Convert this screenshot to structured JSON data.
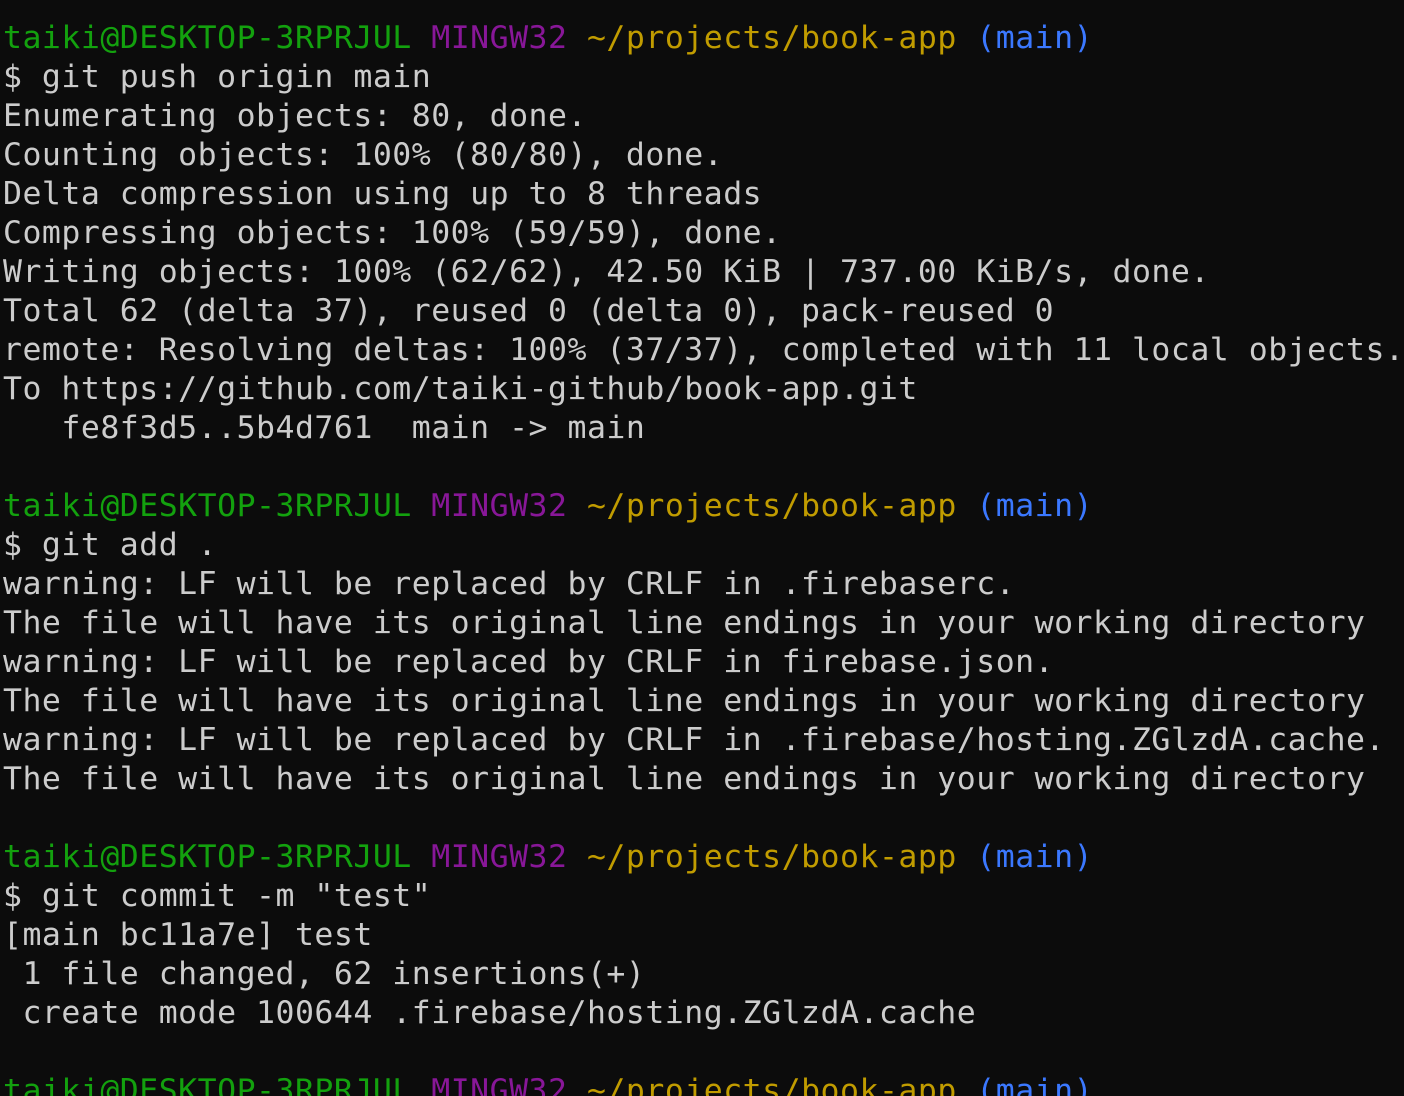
{
  "colors": {
    "background": "#0c0c0c",
    "foreground": "#cccccc",
    "user": "#13a10e",
    "env": "#881798",
    "path": "#c19c00",
    "branch": "#3b78ff"
  },
  "prompt": {
    "user_host": "taiki@DESKTOP-3RPRJUL",
    "env": "MINGW32",
    "path": "~/projects/book-app",
    "branch": "(main)"
  },
  "blocks": [
    {
      "command": "$ git push origin main",
      "output": [
        "Enumerating objects: 80, done.",
        "Counting objects: 100% (80/80), done.",
        "Delta compression using up to 8 threads",
        "Compressing objects: 100% (59/59), done.",
        "Writing objects: 100% (62/62), 42.50 KiB | 737.00 KiB/s, done.",
        "Total 62 (delta 37), reused 0 (delta 0), pack-reused 0",
        "remote: Resolving deltas: 100% (37/37), completed with 11 local objects.",
        "To https://github.com/taiki-github/book-app.git",
        "   fe8f3d5..5b4d761  main -> main"
      ]
    },
    {
      "command": "$ git add .",
      "output": [
        "warning: LF will be replaced by CRLF in .firebaserc.",
        "The file will have its original line endings in your working directory",
        "warning: LF will be replaced by CRLF in firebase.json.",
        "The file will have its original line endings in your working directory",
        "warning: LF will be replaced by CRLF in .firebase/hosting.ZGlzdA.cache.",
        "The file will have its original line endings in your working directory"
      ]
    },
    {
      "command": "$ git commit -m \"test\"",
      "output": [
        "[main bc11a7e] test",
        " 1 file changed, 62 insertions(+)",
        " create mode 100644 .firebase/hosting.ZGlzdA.cache"
      ]
    }
  ]
}
